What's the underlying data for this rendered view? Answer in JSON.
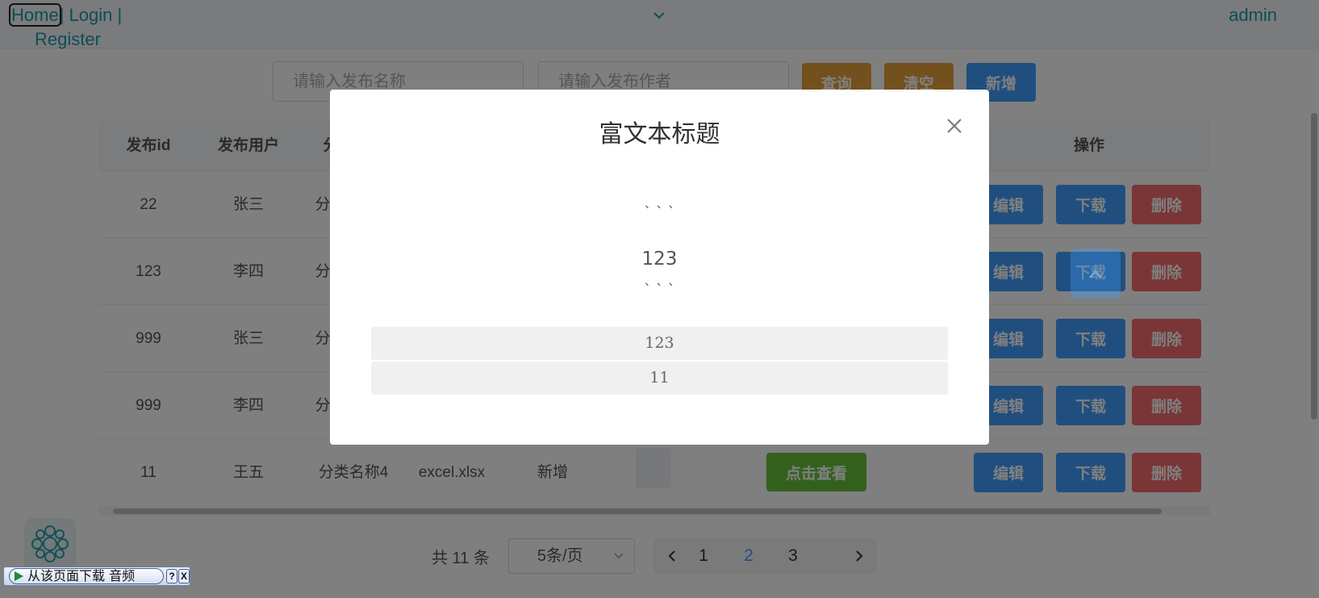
{
  "nav": {
    "home": "Home",
    "sep": "|",
    "login": "Login",
    "register": "Register",
    "user": "admin"
  },
  "search": {
    "name_placeholder": "请输入发布名称",
    "author_placeholder": "请输入发布作者",
    "query_label": "查询",
    "clear_label": "清空",
    "add_label": "新增"
  },
  "table": {
    "headers": {
      "id": "发布id",
      "user": "发布用户",
      "category_partial": "分",
      "actions": "操作"
    },
    "rows": [
      {
        "id": "22",
        "user": "张三",
        "category": "分"
      },
      {
        "id": "123",
        "user": "李四",
        "category": "分"
      },
      {
        "id": "999",
        "user": "张三",
        "category": "分"
      },
      {
        "id": "999",
        "user": "李四",
        "category": "分"
      },
      {
        "id": "11",
        "user": "王五",
        "category": "分类名称4",
        "file": "excel.xlsx",
        "status": "新增",
        "view_label": "点击查看"
      }
    ],
    "edit_label": "编辑",
    "download_label": "下载",
    "delete_label": "删除"
  },
  "pagination": {
    "total": "共 11 条",
    "page_size": "5条/页",
    "pages": [
      "1",
      "2",
      "3"
    ],
    "current": "2"
  },
  "modal": {
    "title": "富文本标题",
    "line1": "` ` `",
    "line2": "123",
    "line3": "` ` `",
    "code1": "123",
    "code2": "11"
  },
  "download_bar": {
    "label": "从该页面下载 音频",
    "help": "?",
    "close": "X"
  },
  "colors": {
    "link": "#1a9ab0",
    "orange": "#e6a23c",
    "blue": "#409eff",
    "red": "#f56c6c",
    "green": "#67c23a"
  }
}
